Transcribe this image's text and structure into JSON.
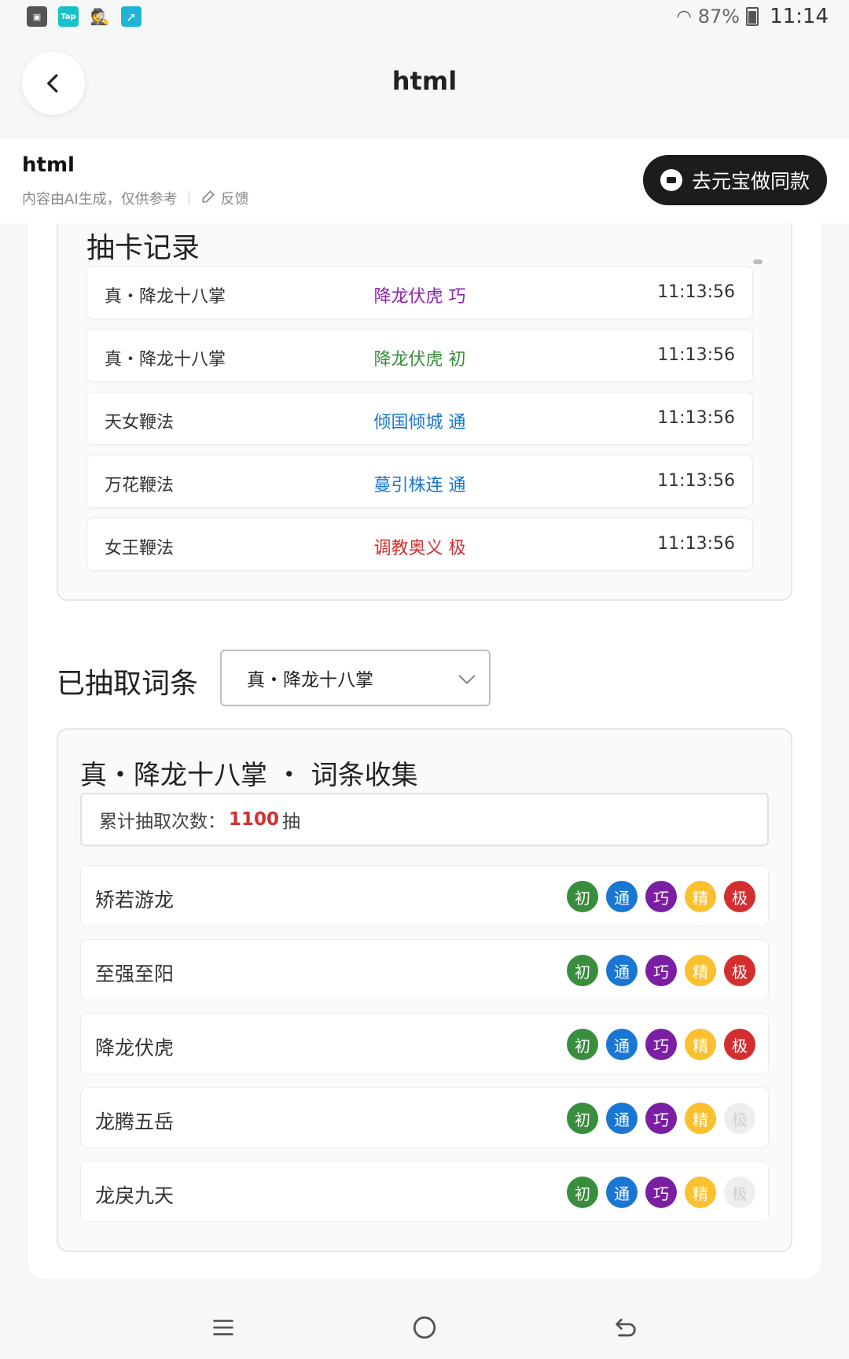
{
  "status_bar": {
    "tap_label": "Tap",
    "battery": "87%",
    "time": "11:14"
  },
  "header": {
    "title": "html"
  },
  "info_bar": {
    "title": "html",
    "disclaimer": "内容由AI生成，仅供参考",
    "feedback": "反馈",
    "make_same": "去元宝做同款"
  },
  "records": {
    "title": "抽卡记录",
    "rows": [
      {
        "name": "真・降龙十八掌",
        "result": "降龙伏虎 巧",
        "color": "#8e24aa",
        "time": "11:13:56"
      },
      {
        "name": "真・降龙十八掌",
        "result": "降龙伏虎 初",
        "color": "#388e3c",
        "time": "11:13:56"
      },
      {
        "name": "天女鞭法",
        "result": "倾国倾城 通",
        "color": "#1976d2",
        "time": "11:13:56"
      },
      {
        "name": "万花鞭法",
        "result": "蔓引株连 通",
        "color": "#1976d2",
        "time": "11:13:56"
      },
      {
        "name": "女王鞭法",
        "result": "调教奥义 极",
        "color": "#d32f2f",
        "time": "11:13:56"
      }
    ]
  },
  "drawn": {
    "label": "已抽取词条",
    "selected": "真・降龙十八掌"
  },
  "collection": {
    "title": "真・降龙十八掌 ・ 词条收集",
    "count_prefix": "累计抽取次数：",
    "count": "1100",
    "count_suffix": "抽",
    "tier_labels": [
      "初",
      "通",
      "巧",
      "精",
      "极"
    ],
    "tier_colors": [
      "#388e3c",
      "#1976d2",
      "#7b1fa2",
      "#fbc02d",
      "#d32f2f"
    ],
    "inactive_color": "#eeeeee",
    "entries": [
      {
        "name": "矫若游龙",
        "unlocked": [
          true,
          true,
          true,
          true,
          true
        ]
      },
      {
        "name": "至强至阳",
        "unlocked": [
          true,
          true,
          true,
          true,
          true
        ]
      },
      {
        "name": "降龙伏虎",
        "unlocked": [
          true,
          true,
          true,
          true,
          true
        ]
      },
      {
        "name": "龙腾五岳",
        "unlocked": [
          true,
          true,
          true,
          true,
          false
        ]
      },
      {
        "name": "龙戾九天",
        "unlocked": [
          true,
          true,
          true,
          true,
          false
        ]
      }
    ]
  }
}
